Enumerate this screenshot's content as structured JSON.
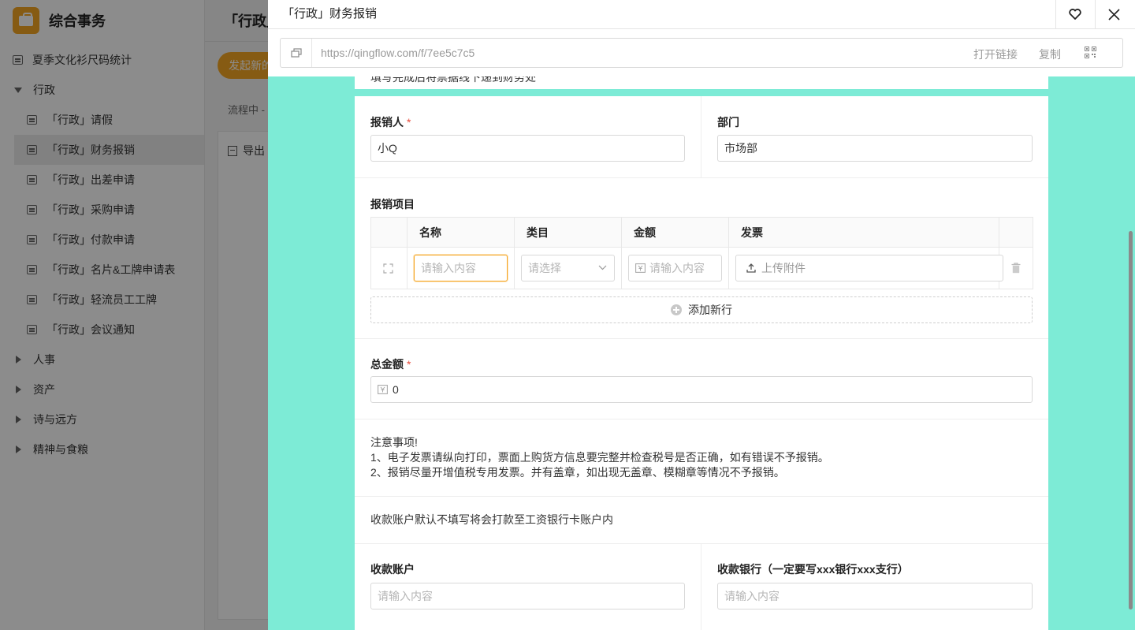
{
  "app": {
    "title": "综合事务",
    "sidebar": {
      "items": [
        {
          "label": "夏季文化衫尺码统计"
        },
        {
          "label": "行政"
        },
        {
          "label": "「行政」请假"
        },
        {
          "label": "「行政」财务报销"
        },
        {
          "label": "「行政」出差申请"
        },
        {
          "label": "「行政」采购申请"
        },
        {
          "label": "「行政」付款申请"
        },
        {
          "label": "「行政」名片&工牌申请表"
        },
        {
          "label": "「行政」轻流员工工牌"
        },
        {
          "label": "「行政」会议通知"
        },
        {
          "label": "人事"
        },
        {
          "label": "资产"
        },
        {
          "label": "诗与远方"
        },
        {
          "label": "精神与食粮"
        }
      ]
    },
    "main": {
      "title": "「行政」",
      "start_button": "发起新的",
      "status": "流程中 -",
      "export": "导出"
    }
  },
  "drawer": {
    "title": "「行政」财务报销",
    "url": "https://qingflow.com/f/7ee5c7c5",
    "open_link": "打开链接",
    "copy": "复制"
  },
  "form": {
    "intro_text": "填写完成后将票据线下递到财务处",
    "reporter": {
      "label": "报销人",
      "required": "*",
      "value": "小Q"
    },
    "department": {
      "label": "部门",
      "value": "市场部"
    },
    "items": {
      "label": "报销项目",
      "columns": [
        "名称",
        "类目",
        "金额",
        "发票"
      ],
      "name_placeholder": "请输入内容",
      "category_placeholder": "请选择",
      "amount_placeholder": "请输入内容",
      "upload_label": "上传附件",
      "add_row": "添加新行"
    },
    "total": {
      "label": "总金额",
      "required": "*",
      "value": "0"
    },
    "notice": {
      "line1": "注意事项!",
      "line2": "1、电子发票请纵向打印，票面上购货方信息要完整并检查税号是否正确，如有错误不予报销。",
      "line3": "2、报销尽量开增值税专用发票。并有盖章，如出现无盖章、模糊章等情况不予报销。"
    },
    "account_note": "收款账户默认不填写将会打款至工资银行卡账户内",
    "account": {
      "label": "收款账户",
      "placeholder": "请输入内容"
    },
    "bank": {
      "label": "收款银行（一定要写xxx银行xxx支行）",
      "placeholder": "请输入内容"
    }
  },
  "colors": {
    "accent": "#f5a623",
    "drawer_bg": "#7debd6",
    "required": "#e74c3c"
  }
}
